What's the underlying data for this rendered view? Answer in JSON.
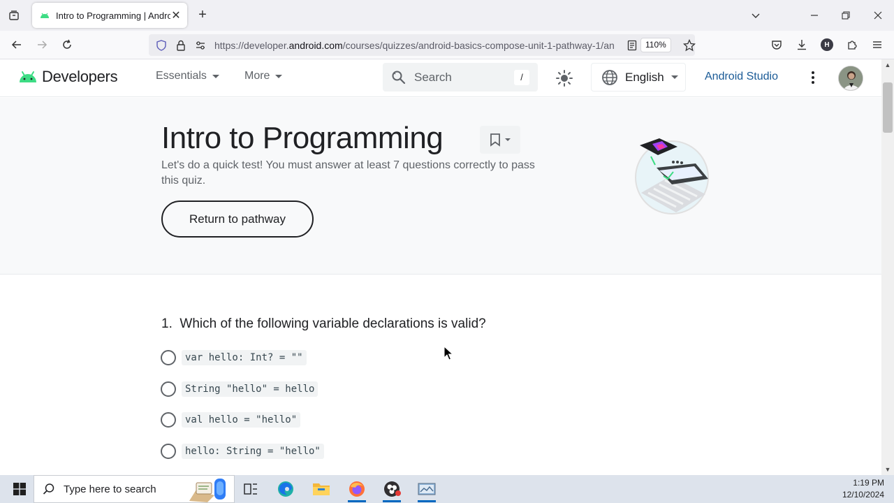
{
  "browser": {
    "tab_title": "Intro to Programming  |  Android",
    "url_prefix": "https://developer.",
    "url_domain": "android.com",
    "url_path": "/courses/quizzes/android-basics-compose-unit-1-pathway-1/an",
    "zoom": "110%",
    "profile_initial": "H"
  },
  "site": {
    "brand": "Developers",
    "menu": [
      {
        "label": "Essentials"
      },
      {
        "label": "More"
      }
    ],
    "search_placeholder": "Search",
    "search_shortcut": "/",
    "language": "English",
    "studio_link": "Android Studio"
  },
  "hero": {
    "title": "Intro to Programming",
    "description": "Let's do a quick test! You must answer at least 7 questions correctly to pass this quiz.",
    "return_button": "Return to pathway"
  },
  "question": {
    "number": "1.",
    "text": "Which of the following variable declarations is valid?",
    "options": [
      {
        "code": "var hello: Int? = \"\""
      },
      {
        "code": "String \"hello\" = hello"
      },
      {
        "code": "val hello = \"hello\""
      },
      {
        "code": "hello: String = \"hello\""
      }
    ]
  },
  "taskbar": {
    "search_text": "Type here to search",
    "time": "1:19 PM",
    "date": "12/10/2024"
  },
  "colors": {
    "android_green": "#3ddc84",
    "link_blue": "#1a5a96",
    "firefox_orange": "#ff7139"
  }
}
